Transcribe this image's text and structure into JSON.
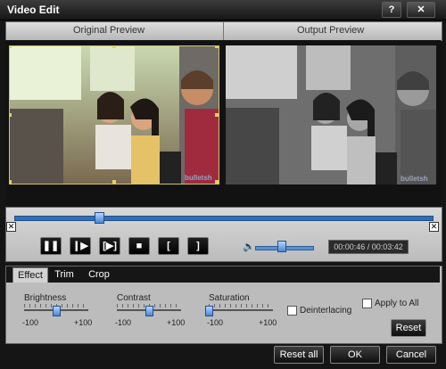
{
  "window": {
    "title": "Video Edit",
    "help_label": "?",
    "close_label": "✕"
  },
  "preview": {
    "original_label": "Original Preview",
    "output_label": "Output Preview"
  },
  "playback": {
    "progress": 0.2,
    "time_text": "00:00:46 / 00:03:42",
    "volume": 0.45,
    "buttons": {
      "pause": "❚❚",
      "step": "❙▶",
      "frame": "[▶]",
      "stop": "■",
      "mark_in": "[",
      "mark_out": "]"
    }
  },
  "tabs": [
    {
      "label": "Effect"
    },
    {
      "label": "Trim"
    },
    {
      "label": "Crop"
    }
  ],
  "effect": {
    "brightness": {
      "label": "Brightness",
      "min": "-100",
      "max": "+100",
      "value": 0
    },
    "contrast": {
      "label": "Contrast",
      "min": "-100",
      "max": "+100",
      "value": 0
    },
    "saturation": {
      "label": "Saturation",
      "min": "-100",
      "max": "+100",
      "value": -100
    },
    "deinterlacing_label": "Deinterlacing",
    "apply_to_all_label": "Apply to All",
    "reset_label": "Reset"
  },
  "footer": {
    "reset_all_label": "Reset all",
    "ok_label": "OK",
    "cancel_label": "Cancel"
  },
  "colors": {
    "accent": "#3b7fd2",
    "crop_frame": "#d5c55a"
  }
}
